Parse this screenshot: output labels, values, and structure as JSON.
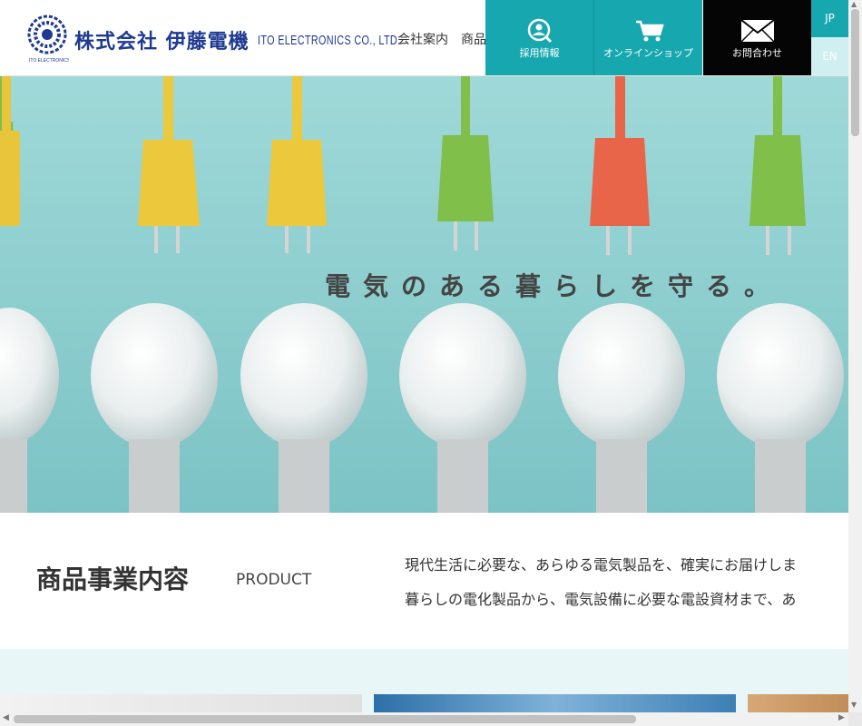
{
  "header": {
    "logo_ja": "株式会社 伊藤電機",
    "logo_en": "ITO ELECTRONICS CO., LTD.",
    "logo_emblem_text": "ITO ELECTRONICS",
    "nav": [
      "会社案内",
      "商品"
    ],
    "buttons": {
      "recruit": {
        "label": "採用情報",
        "icon": "person-search-icon"
      },
      "shop": {
        "label": "オンラインショップ",
        "icon": "shopping-cart-icon"
      },
      "contact": {
        "label": "お問合わせ",
        "icon": "envelope-icon"
      }
    },
    "lang": {
      "jp": "JP",
      "en": "EN"
    },
    "accent_color": "#17a7ae"
  },
  "hero": {
    "tagline": "電気のある暮らしを守る。"
  },
  "product": {
    "title": "商品事業内容",
    "title_en": "PRODUCT",
    "desc_line1": "現代生活に必要な、あらゆる電気製品を、確実にお届けしま",
    "desc_line2": "暮らしの電化製品から、電気設備に必要な電設資材まで、あ"
  }
}
